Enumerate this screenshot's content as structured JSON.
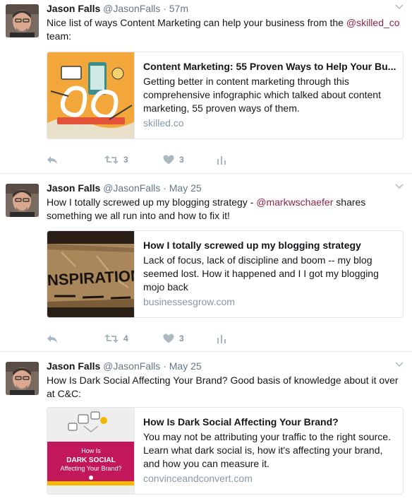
{
  "tweets": [
    {
      "name": "Jason Falls",
      "handle": "@JasonFalls",
      "dot": "·",
      "time": "57m",
      "text_before": "Nice list of ways Content Marketing can help your business from the ",
      "mention": "@skilled_co",
      "text_after": " team:",
      "card": {
        "title": "Content Marketing: 55 Proven Ways to Help Your Bu...",
        "description": "Getting better in content marketing through this comprehensive infographic which talked about content marketing, 55 proven ways of them.",
        "domain": "skilled.co"
      },
      "retweets": "3",
      "likes": "3"
    },
    {
      "name": "Jason Falls",
      "handle": "@JasonFalls",
      "dot": "·",
      "time": "May 25",
      "text_before": "How I totally screwed up my blogging strategy - ",
      "mention": "@markwschaefer",
      "text_after": " shares something we all run into and how to fix it!",
      "card": {
        "title": "How I totally screwed up my blogging strategy",
        "description": "Lack of focus, lack of discipline and boom -- my blog seemed lost. How it happened and I I got my blogging mojo back",
        "domain": "businessesgrow.com",
        "image_text": "INSPIRATION"
      },
      "retweets": "4",
      "likes": "3"
    },
    {
      "name": "Jason Falls",
      "handle": "@JasonFalls",
      "dot": "·",
      "time": "May 25",
      "text_before": "How Is Dark Social Affecting Your Brand? Good basis of knowledge about it over at C&C:",
      "mention": "",
      "text_after": "",
      "card": {
        "title": "How Is Dark Social Affecting Your Brand?",
        "description": "You may not be attributing your traffic to the right source. Learn what dark social is, how it's affecting your brand, and how you can measure it.",
        "domain": "convinceandconvert.com",
        "image_line1": "How Is",
        "image_line2": "DARK SOCIAL",
        "image_line3": "Affecting Your Brand?"
      }
    }
  ],
  "colors": {
    "mention": "#8e2545",
    "muted": "#657786",
    "action_icon": "#aab8c2",
    "border": "#e1e8ed"
  },
  "icons": [
    "avatar",
    "chevron-down-icon",
    "reply-icon",
    "retweet-icon",
    "heart-icon",
    "analytics-icon"
  ]
}
